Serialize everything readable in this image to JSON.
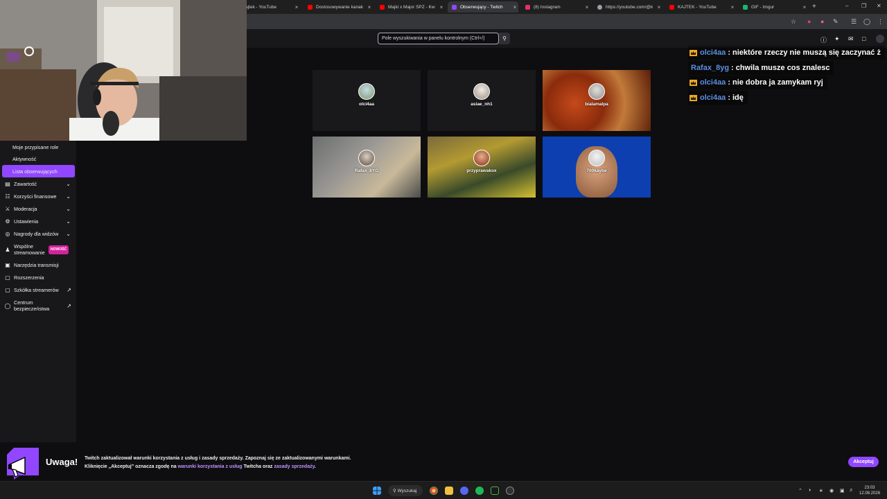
{
  "browser": {
    "tabs": [
      {
        "title": "ajtek - YouTube",
        "fav_color": "#ff0000"
      },
      {
        "title": "Dostosowywanie kanału",
        "fav_color": "#ff0000"
      },
      {
        "title": "Majki x Major SPZ - Kwa",
        "fav_color": "#ff0000"
      },
      {
        "title": "Obserwujący - Twitch",
        "fav_color": "#9147ff"
      },
      {
        "title": "(8) Instagram",
        "fav_color": "#e1306c"
      },
      {
        "title": "https://youtube.com/@k",
        "fav_color": "#9aa0a6"
      },
      {
        "title": "KAJTEK - YouTube",
        "fav_color": "#ff0000"
      },
      {
        "title": "GIF - Imgur",
        "fav_color": "#1bb76e"
      }
    ],
    "close_glyph": "×",
    "new_tab_glyph": "+"
  },
  "topnav": {
    "search_placeholder": "Pole wyszukiwania w panelu kontrolnym (Ctrl+/)"
  },
  "sidebar": {
    "items": [
      {
        "label": "Moje przypisane role",
        "sub": true
      },
      {
        "label": "Aktywność",
        "sub": true
      },
      {
        "label": "Lista obserwujących",
        "sub": true,
        "active": true
      },
      {
        "label": "Zawartość",
        "icon": "content-icon",
        "chevron": true
      },
      {
        "label": "Korzyści finansowe",
        "icon": "money-icon",
        "chevron": true
      },
      {
        "label": "Moderacja",
        "icon": "sword-icon",
        "chevron": true
      },
      {
        "label": "Ustawienia",
        "icon": "gear-icon",
        "chevron": true
      },
      {
        "label": "Nagrody dla widzów",
        "icon": "gift-icon",
        "chevron": true
      },
      {
        "label_line1": "Wspólne",
        "label_line2": "streamowanie",
        "icon": "people-icon",
        "badge": "NOWOŚĆ"
      },
      {
        "label": "Narzędzia transmisji",
        "icon": "broadcast-icon"
      },
      {
        "label": "Rozszerzenia",
        "icon": "puzzle-icon"
      },
      {
        "label": "Szkółka streamerów",
        "icon": "school-icon",
        "external": true
      },
      {
        "label_line1": "Centrum",
        "label_line2": "bezpieczeństwa",
        "icon": "shield-icon",
        "external": true
      }
    ]
  },
  "followers": [
    {
      "name": "olci4aa"
    },
    {
      "name": "asiae_nh1"
    },
    {
      "name": "bialamalpa"
    },
    {
      "name": "Rafax_8YG"
    },
    {
      "name": "przyprawakox"
    },
    {
      "name": "700kaybe"
    }
  ],
  "chat": [
    {
      "user": "olci4aa",
      "text": "niektóre rzeczy nie muszą się zaczynać ż",
      "crown": true
    },
    {
      "user": "Rafax_8yg",
      "text": "chwila musze cos znalesc",
      "crown": false
    },
    {
      "user": "olci4aa",
      "text": "nie dobra ja zamykam ryj",
      "crown": true
    },
    {
      "user": "olci4aa",
      "text": "idę",
      "crown": true
    }
  ],
  "banner": {
    "title": "Uwaga!",
    "line1": "Twitch zaktualizował warunki korzystania z usług i zasady sprzedaży. Zapoznaj się ze zaktualizowanymi warunkami.",
    "line2_a": "Kliknięcie „Akceptuj” oznacza zgodę na ",
    "line2_link1": "warunki korzystania z usług",
    "line2_b": " Twitcha oraz ",
    "line2_link2": "zasady sprzedaży",
    "line2_c": ".",
    "accept": "Akceptuj"
  },
  "taskbar": {
    "search": "Wyszukaj",
    "time": "23:03",
    "date": "12.08.2026"
  },
  "colors": {
    "accent": "#9147ff",
    "chat_user": "#5c8ee0",
    "badge": "#d4239b"
  }
}
